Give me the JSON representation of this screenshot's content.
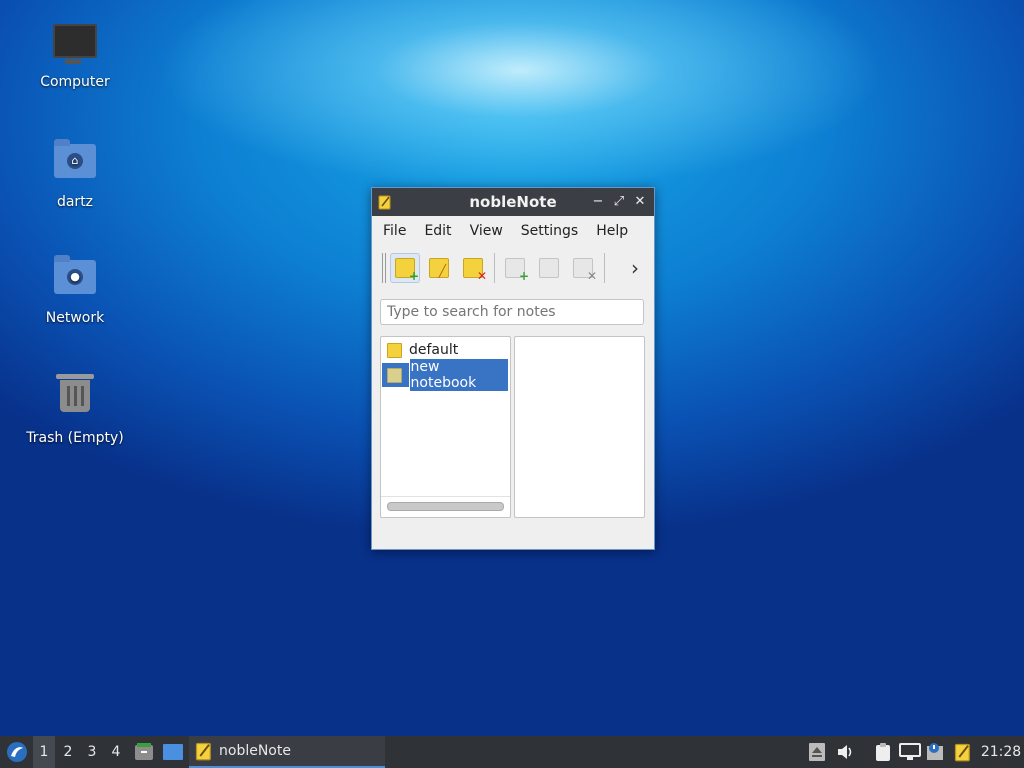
{
  "desktop": {
    "icons": [
      {
        "label": "Computer",
        "icon": "computer-icon"
      },
      {
        "label": "dartz",
        "icon": "home-folder-icon"
      },
      {
        "label": "Network",
        "icon": "network-folder-icon"
      },
      {
        "label": "Trash (Empty)",
        "icon": "trash-icon"
      }
    ]
  },
  "window": {
    "title": "nobleNote",
    "controls": {
      "minimize": "−",
      "maximize": "⤢",
      "close": "✕"
    },
    "menu": [
      "File",
      "Edit",
      "View",
      "Settings",
      "Help"
    ],
    "toolbar": {
      "buttons": [
        "new-note",
        "edit-note",
        "delete-note",
        "new-notebook",
        "rename-notebook",
        "delete-notebook"
      ],
      "overflow": "›"
    },
    "search": {
      "placeholder": "Type to search for notes"
    },
    "notebooks": [
      {
        "label": "default",
        "selected": false
      },
      {
        "label": "new notebook",
        "selected": true,
        "editing": true
      }
    ]
  },
  "taskbar": {
    "workspaces": [
      "1",
      "2",
      "3",
      "4"
    ],
    "active_workspace": "1",
    "task": {
      "label": "nobleNote"
    },
    "clock": "21:28"
  },
  "colors": {
    "selection": "#3873c4",
    "titlebar": "#3b3e44",
    "taskbar": "#2f3237",
    "note_yellow": "#f3d23e"
  }
}
